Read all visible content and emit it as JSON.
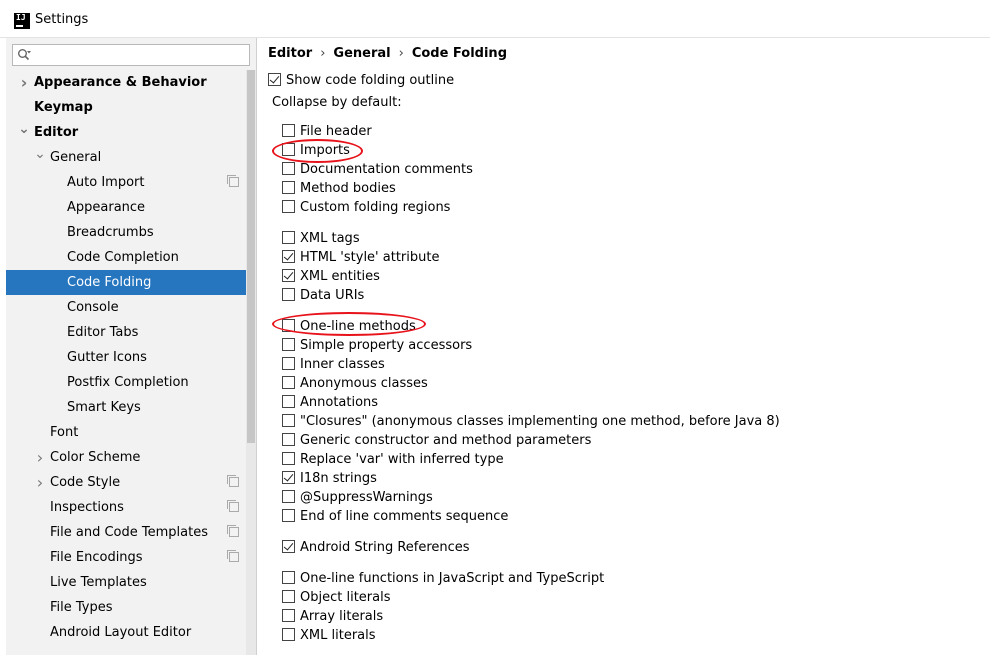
{
  "window": {
    "title": "Settings",
    "app_icon_text": "IJ"
  },
  "search": {
    "placeholder": "",
    "value": ""
  },
  "sidebar": {
    "items": [
      {
        "label": "Appearance & Behavior",
        "level": 0,
        "arrow": "right",
        "bold": true,
        "copy": false
      },
      {
        "label": "Keymap",
        "level": 0,
        "arrow": "",
        "bold": true,
        "copy": false
      },
      {
        "label": "Editor",
        "level": 0,
        "arrow": "down",
        "bold": true,
        "copy": false
      },
      {
        "label": "General",
        "level": 1,
        "arrow": "down",
        "bold": false,
        "copy": false
      },
      {
        "label": "Auto Import",
        "level": 2,
        "arrow": "",
        "bold": false,
        "copy": true
      },
      {
        "label": "Appearance",
        "level": 2,
        "arrow": "",
        "bold": false,
        "copy": false
      },
      {
        "label": "Breadcrumbs",
        "level": 2,
        "arrow": "",
        "bold": false,
        "copy": false
      },
      {
        "label": "Code Completion",
        "level": 2,
        "arrow": "",
        "bold": false,
        "copy": false
      },
      {
        "label": "Code Folding",
        "level": 2,
        "arrow": "",
        "bold": false,
        "copy": false,
        "selected": true
      },
      {
        "label": "Console",
        "level": 2,
        "arrow": "",
        "bold": false,
        "copy": false
      },
      {
        "label": "Editor Tabs",
        "level": 2,
        "arrow": "",
        "bold": false,
        "copy": false
      },
      {
        "label": "Gutter Icons",
        "level": 2,
        "arrow": "",
        "bold": false,
        "copy": false
      },
      {
        "label": "Postfix Completion",
        "level": 2,
        "arrow": "",
        "bold": false,
        "copy": false
      },
      {
        "label": "Smart Keys",
        "level": 2,
        "arrow": "",
        "bold": false,
        "copy": false
      },
      {
        "label": "Font",
        "level": 1,
        "arrow": "",
        "bold": false,
        "copy": false
      },
      {
        "label": "Color Scheme",
        "level": 1,
        "arrow": "right",
        "bold": false,
        "copy": false
      },
      {
        "label": "Code Style",
        "level": 1,
        "arrow": "right",
        "bold": false,
        "copy": true
      },
      {
        "label": "Inspections",
        "level": 1,
        "arrow": "",
        "bold": false,
        "copy": true
      },
      {
        "label": "File and Code Templates",
        "level": 1,
        "arrow": "",
        "bold": false,
        "copy": true
      },
      {
        "label": "File Encodings",
        "level": 1,
        "arrow": "",
        "bold": false,
        "copy": true
      },
      {
        "label": "Live Templates",
        "level": 1,
        "arrow": "",
        "bold": false,
        "copy": false
      },
      {
        "label": "File Types",
        "level": 1,
        "arrow": "",
        "bold": false,
        "copy": false
      },
      {
        "label": "Android Layout Editor",
        "level": 1,
        "arrow": "",
        "bold": false,
        "copy": false
      }
    ]
  },
  "breadcrumb": [
    "Editor",
    "General",
    "Code Folding"
  ],
  "breadcrumb_separator": "›",
  "main": {
    "show_outline": {
      "label": "Show code folding outline",
      "checked": true
    },
    "collapse_label": "Collapse by default:",
    "options": [
      {
        "label": "File header",
        "checked": false
      },
      {
        "label": "Imports",
        "checked": false
      },
      {
        "label": "Documentation comments",
        "checked": false
      },
      {
        "label": "Method bodies",
        "checked": false
      },
      {
        "label": "Custom folding regions",
        "checked": false
      },
      {
        "label": "XML tags",
        "checked": false
      },
      {
        "label": "HTML 'style' attribute",
        "checked": true
      },
      {
        "label": "XML entities",
        "checked": true
      },
      {
        "label": "Data URIs",
        "checked": false
      },
      {
        "label": "One-line methods",
        "checked": false
      },
      {
        "label": "Simple property accessors",
        "checked": false
      },
      {
        "label": "Inner classes",
        "checked": false
      },
      {
        "label": "Anonymous classes",
        "checked": false
      },
      {
        "label": "Annotations",
        "checked": false
      },
      {
        "label": "\"Closures\" (anonymous classes implementing one method, before Java 8)",
        "checked": false
      },
      {
        "label": "Generic constructor and method parameters",
        "checked": false
      },
      {
        "label": "Replace 'var' with inferred type",
        "checked": false
      },
      {
        "label": "I18n strings",
        "checked": true
      },
      {
        "label": "@SuppressWarnings",
        "checked": false
      },
      {
        "label": "End of line comments sequence",
        "checked": false
      },
      {
        "label": "Android String References",
        "checked": true
      },
      {
        "label": "One-line functions in JavaScript and TypeScript",
        "checked": false
      },
      {
        "label": "Object literals",
        "checked": false
      },
      {
        "label": "Array literals",
        "checked": false
      },
      {
        "label": "XML literals",
        "checked": false
      }
    ]
  },
  "colors": {
    "selection": "#2675bf",
    "annotation": "#e8121a",
    "sidebar_bg": "#f2f2f2"
  }
}
